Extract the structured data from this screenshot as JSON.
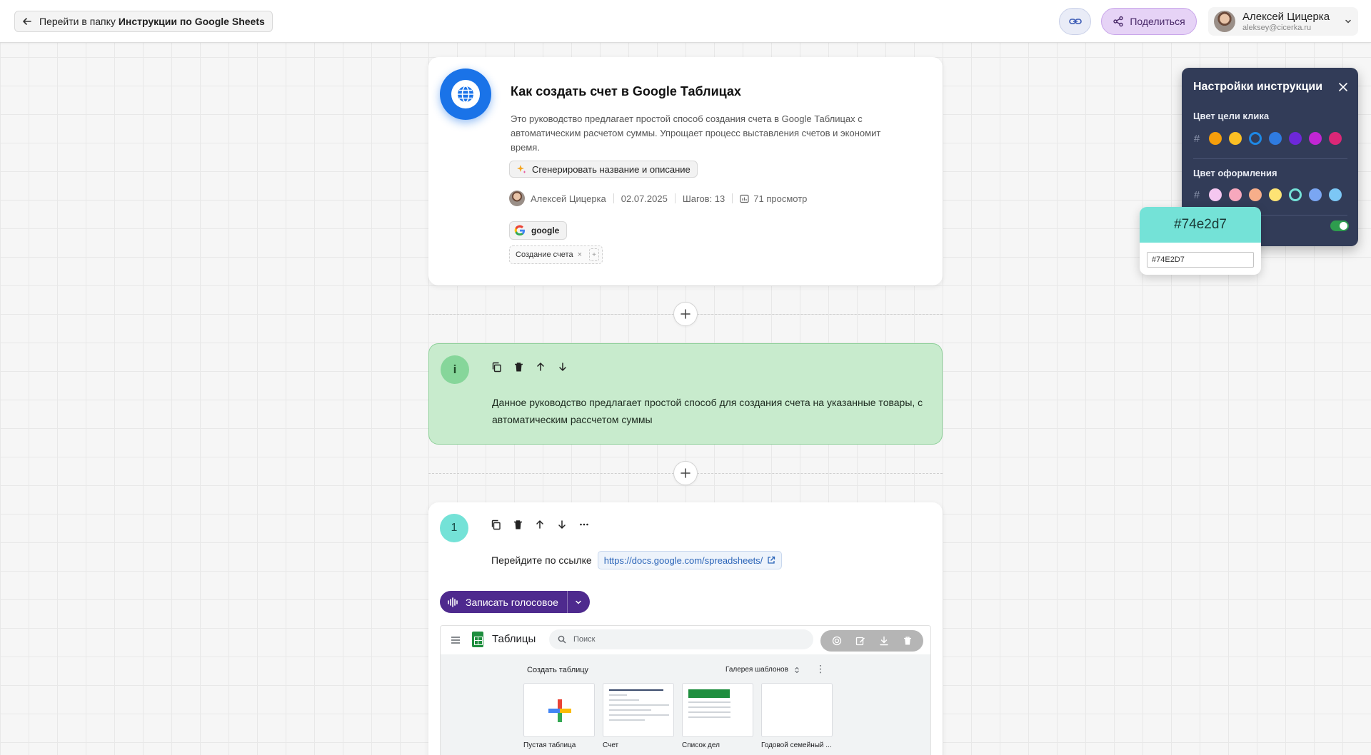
{
  "topbar": {
    "back_prefix": "Перейти в папку",
    "back_folder": "Инструкции по Google Sheets",
    "share_label": "Поделиться",
    "user_name": "Алексей Цицерка",
    "user_email": "aleksey@cicerka.ru"
  },
  "intro": {
    "title": "Как создать счет в Google Таблицах",
    "description": "Это руководство предлагает простой способ создания счета в Google Таблицах с автоматическим расчетом суммы. Упрощает процесс выставления счетов и экономит время.",
    "generate_label": "Сгенерировать название и описание",
    "author": "Алексей Цицерка",
    "date": "02.07.2025",
    "steps": "Шагов: 13",
    "views": "71 просмотр",
    "app_tag": "google",
    "tags": [
      "Создание счета"
    ],
    "tag_add": "+"
  },
  "info_block": {
    "badge": "i",
    "text": "Данное руководство предлагает простой способ для создания счета на указанные товары, с автоматическим рассчетом суммы",
    "color": "#c8ebcd"
  },
  "step1": {
    "number": "1",
    "instruction": "Перейдите по ссылке",
    "url": "https://docs.google.com/spreadsheets/",
    "voice_label": "Записать голосовое",
    "badge_color": "#74e2d7"
  },
  "screenshot": {
    "app_name": "Таблицы",
    "search_placeholder": "Поиск",
    "create_label": "Создать таблицу",
    "gallery_label": "Галерея шаблонов",
    "templates": [
      "Пустая таблица",
      "Счет",
      "Список дел",
      "Годовой семейный ..."
    ]
  },
  "settings": {
    "title": "Настройки инструкции",
    "click_color_label": "Цвет цели клика",
    "design_color_label": "Цвет оформления",
    "hash_symbol": "#",
    "click_colors": [
      "#f59e0b",
      "#fbbf24",
      "#1e88e5",
      "#2f7be0",
      "#6d28d9",
      "#c026d3",
      "#db2777"
    ],
    "click_selected": 2,
    "design_colors": [
      "#f5c7f0",
      "#f7a8bd",
      "#f7ae8a",
      "#fde374",
      "#74e2d7",
      "#7aa6f2",
      "#7cc7f5"
    ],
    "design_selected": 4
  },
  "color_picker": {
    "preview_value": "#74e2d7",
    "input_value": "#74E2D7",
    "color": "#74e2d7"
  }
}
